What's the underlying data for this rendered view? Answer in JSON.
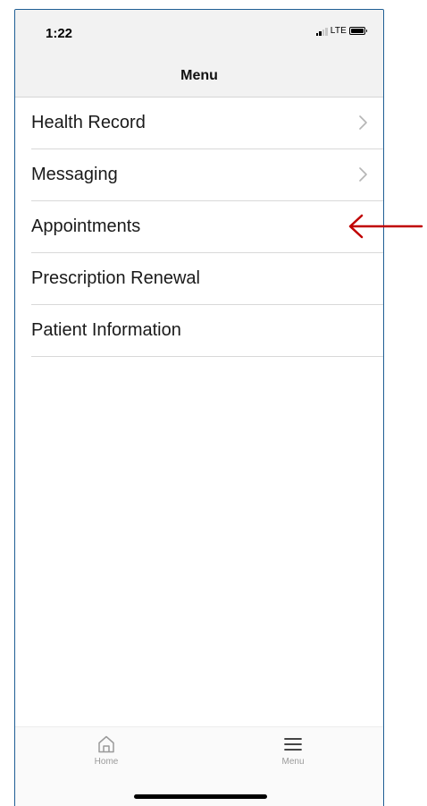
{
  "status_bar": {
    "time": "1:22",
    "network": "LTE"
  },
  "header": {
    "title": "Menu"
  },
  "menu": {
    "items": [
      {
        "label": "Health Record",
        "has_chevron": true
      },
      {
        "label": "Messaging",
        "has_chevron": true
      },
      {
        "label": "Appointments",
        "has_chevron": false
      },
      {
        "label": "Prescription Renewal",
        "has_chevron": false
      },
      {
        "label": "Patient Information",
        "has_chevron": false
      }
    ]
  },
  "tabbar": {
    "home_label": "Home",
    "menu_label": "Menu",
    "home_icon": "home-icon",
    "menu_icon": "hamburger-menu-icon"
  },
  "annotation": {
    "arrow_icon": "left-arrow-icon",
    "arrow_color": "#c00000",
    "points_to": "Appointments"
  },
  "colors": {
    "header_bg": "#f2f2f2",
    "frame_border": "#1f5e94",
    "tab_label": "#9a9a9a"
  }
}
